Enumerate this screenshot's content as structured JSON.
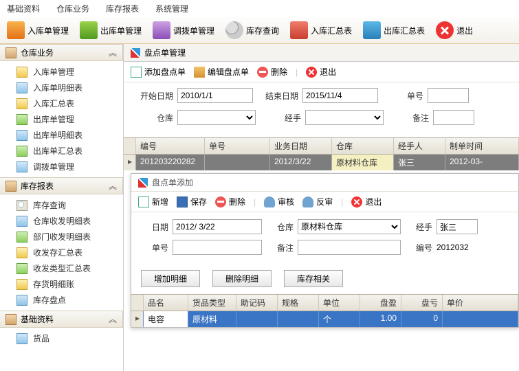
{
  "menu": {
    "items": [
      "基础资料",
      "仓库业务",
      "库存报表",
      "系统管理"
    ]
  },
  "toolbar": {
    "inbound": "入库单管理",
    "outbound": "出库单管理",
    "transfer": "调拨单管理",
    "query": "库存查询",
    "insum": "入库汇总表",
    "outsum": "出库汇总表",
    "exit": "退出"
  },
  "sidebar": {
    "inventory_ops": {
      "title": "仓库业务",
      "items": [
        "入库单管理",
        "入库单明细表",
        "入库汇总表",
        "出库单管理",
        "出库单明细表",
        "出库单汇总表",
        "调拨单管理"
      ]
    },
    "inventory_rpt": {
      "title": "库存报表",
      "items": [
        "库存查询",
        "仓库收发明细表",
        "部门收发明细表",
        "收发存汇总表",
        "收发类型汇总表",
        "存货明细账",
        "库存盘点"
      ]
    },
    "base": {
      "title": "基础资料",
      "items": [
        "货品"
      ]
    }
  },
  "page": {
    "title": "盘点单管理",
    "actions": {
      "add": "添加盘点单",
      "edit": "编辑盘点单",
      "del": "删除",
      "exit": "退出"
    }
  },
  "filter": {
    "start_label": "开始日期",
    "start_val": "2010/1/1",
    "end_label": "结束日期",
    "end_val": "2015/11/4",
    "num_label": "单号",
    "wh_label": "仓库",
    "hand_label": "经手",
    "remark_label": "备注"
  },
  "grid": {
    "cols": [
      "编号",
      "单号",
      "业务日期",
      "仓库",
      "经手人",
      "制单时间"
    ],
    "row": {
      "id": "201203220282",
      "num": "",
      "date": "2012/3/22",
      "wh": "原材料仓库",
      "hand": "张三",
      "ctime": "2012-03-"
    }
  },
  "dialog": {
    "title": "盘点单添加",
    "actions": {
      "new": "新增",
      "save": "保存",
      "del": "删除",
      "audit": "审核",
      "unaudit": "反审",
      "exit": "退出"
    },
    "form": {
      "date_label": "日期",
      "date_val": "2012/ 3/22",
      "wh_label": "仓库",
      "wh_val": "原材料仓库",
      "hand_label": "经手",
      "hand_val": "张三",
      "num_label": "单号",
      "remark_label": "备注",
      "id_label": "编号",
      "id_val": "2012032"
    },
    "btns": {
      "add": "增加明细",
      "del": "删除明细",
      "stock": "库存相关"
    },
    "detailcols": [
      "品名",
      "货品类型",
      "助记码",
      "规格",
      "单位",
      "盘盈",
      "盘亏",
      "单价"
    ],
    "detailrow": {
      "name": "电容",
      "type": "原材料",
      "mnemonic": "",
      "spec": "",
      "unit": "个",
      "over": "1.00",
      "short": "0",
      "price": ""
    }
  }
}
